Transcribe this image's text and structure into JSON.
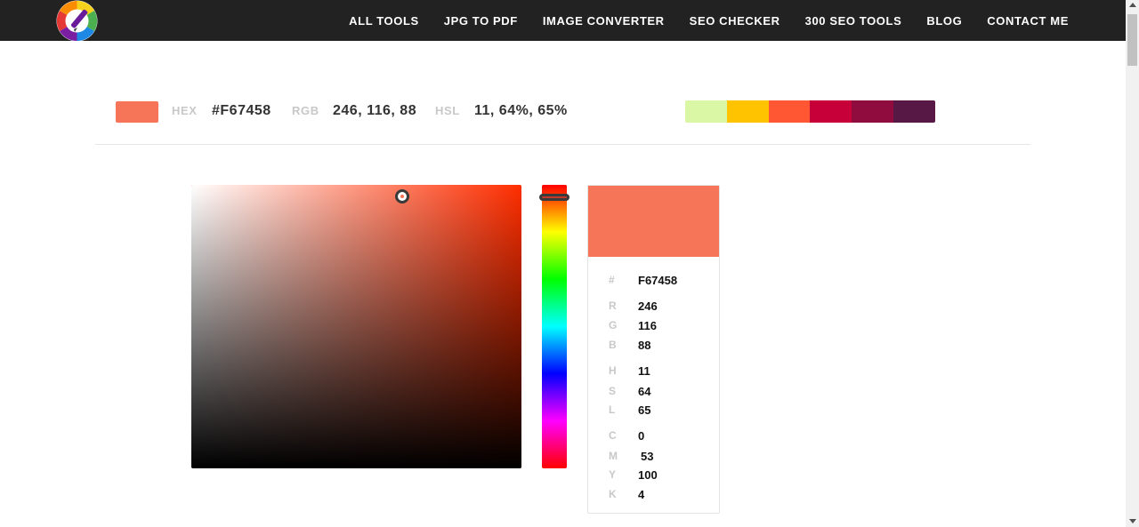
{
  "header": {
    "nav": [
      "ALL TOOLS",
      "JPG TO PDF",
      "IMAGE CONVERTER",
      "SEO CHECKER",
      "300 SEO TOOLS",
      "BLOG",
      "CONTACT ME"
    ],
    "logo_icon": "color-wheel-pencil-icon"
  },
  "color_summary": {
    "swatch_color": "#F67458",
    "hex_label": "HEX",
    "hex_value": "#F67458",
    "rgb_label": "RGB",
    "rgb_value": "246, 116, 88",
    "hsl_label": "HSL",
    "hsl_value": "11, 64%, 65%"
  },
  "palette": [
    "#DAF7A6",
    "#FFC300",
    "#FF5733",
    "#C70039",
    "#900C3F",
    "#581845"
  ],
  "picker": {
    "hue_color": "#FF2E00",
    "saturation": 0.64,
    "brightness": 0.96,
    "hue_position": 0.03
  },
  "details": {
    "preview_color": "#F67458",
    "hex": {
      "key": "#",
      "value": "F67458"
    },
    "rgb": [
      {
        "key": "R",
        "value": "246"
      },
      {
        "key": "G",
        "value": "116"
      },
      {
        "key": "B",
        "value": "88"
      }
    ],
    "hsl": [
      {
        "key": "H",
        "value": "11"
      },
      {
        "key": "S",
        "value": "64"
      },
      {
        "key": "L",
        "value": "65"
      }
    ],
    "cmyk": [
      {
        "key": "C",
        "value": "0"
      },
      {
        "key": "M",
        "value": "53"
      },
      {
        "key": "Y",
        "value": "100"
      },
      {
        "key": "K",
        "value": "4"
      }
    ]
  }
}
